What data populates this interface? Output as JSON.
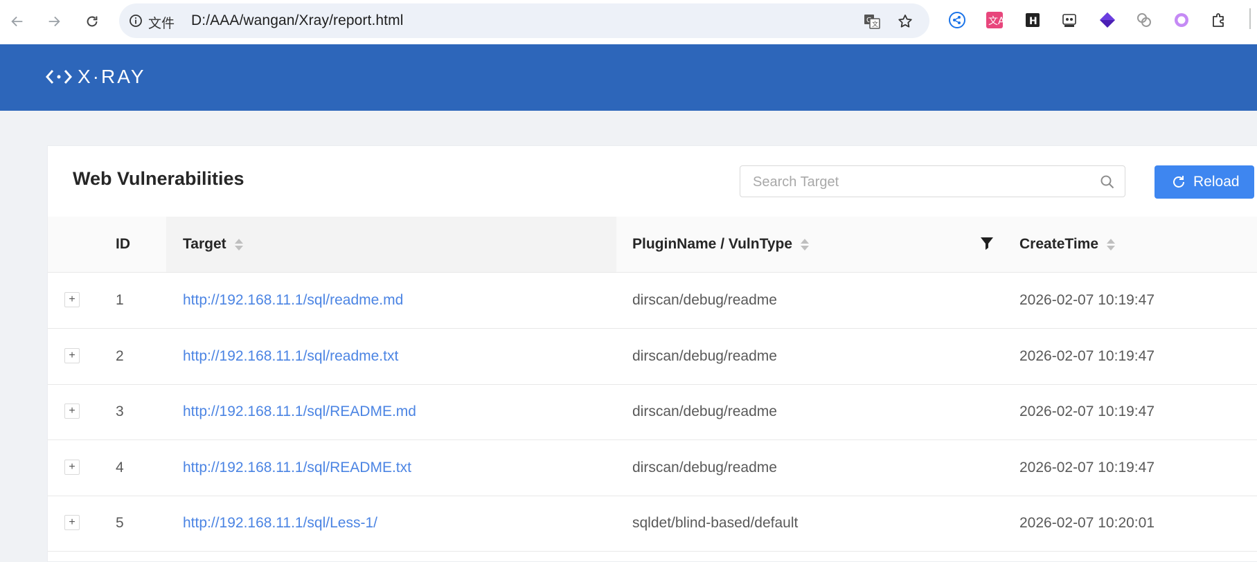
{
  "browser": {
    "chip_label": "文件",
    "url": "D:/AAA/wangan/Xray/report.html"
  },
  "app": {
    "logo_text": "X·RAY"
  },
  "card": {
    "title": "Web Vulnerabilities",
    "search_placeholder": "Search Target",
    "reload_label": "Reload"
  },
  "table": {
    "columns": {
      "id": "ID",
      "target": "Target",
      "plugin": "PluginName / VulnType",
      "time": "CreateTime"
    },
    "rows": [
      {
        "id": "1",
        "target": "http://192.168.11.1/sql/readme.md",
        "plugin": "dirscan/debug/readme",
        "time": "2026-02-07 10:19:47"
      },
      {
        "id": "2",
        "target": "http://192.168.11.1/sql/readme.txt",
        "plugin": "dirscan/debug/readme",
        "time": "2026-02-07 10:19:47"
      },
      {
        "id": "3",
        "target": "http://192.168.11.1/sql/README.md",
        "plugin": "dirscan/debug/readme",
        "time": "2026-02-07 10:19:47"
      },
      {
        "id": "4",
        "target": "http://192.168.11.1/sql/README.txt",
        "plugin": "dirscan/debug/readme",
        "time": "2026-02-07 10:19:47"
      },
      {
        "id": "5",
        "target": "http://192.168.11.1/sql/Less-1/",
        "plugin": "sqldet/blind-based/default",
        "time": "2026-02-07 10:20:01"
      }
    ]
  },
  "colors": {
    "header_blue": "#2d66ba",
    "reload_blue": "#3e86f0",
    "link_blue": "#4b84e3"
  }
}
